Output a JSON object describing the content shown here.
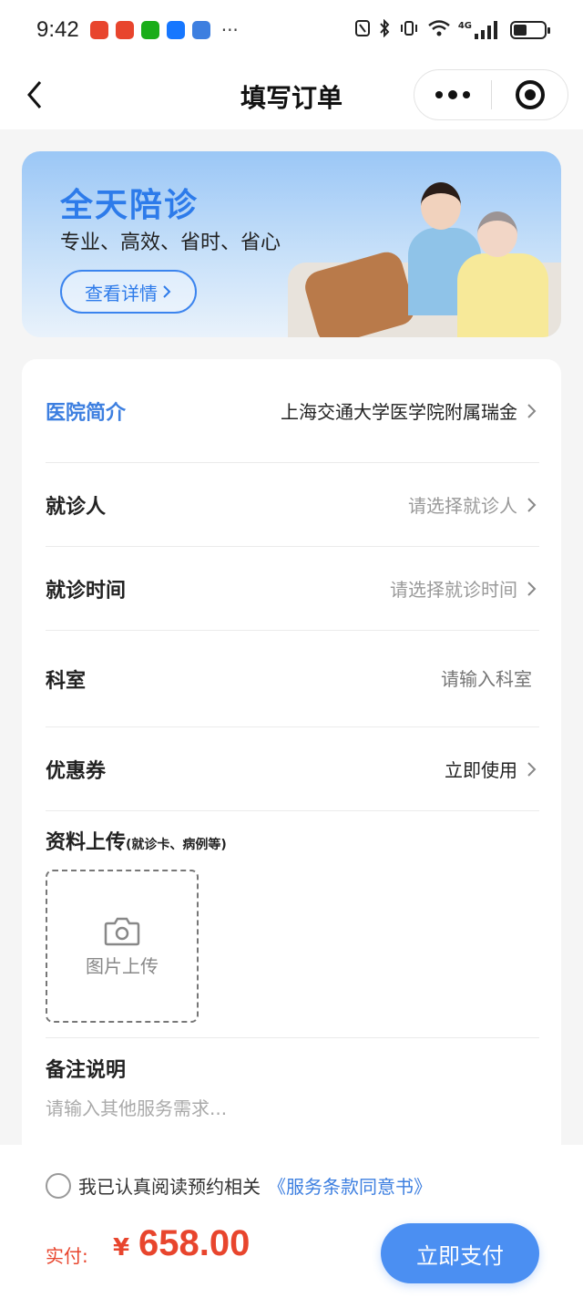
{
  "status_bar": {
    "time": "9:42",
    "more": "···",
    "network_badge": "4G",
    "app_icon_colors": [
      "#e8452d",
      "#e8452d",
      "#1aad19",
      "#1677ff",
      "#3d7fe0"
    ]
  },
  "nav": {
    "title": "填写订单",
    "back_icon": "back-chevron-icon",
    "more_icon": "more-dots-icon",
    "close_icon": "target-icon"
  },
  "banner": {
    "title": "全天陪诊",
    "subtitle": "专业、高效、省时、省心",
    "button_label": "查看详情"
  },
  "form": {
    "hospital": {
      "label": "医院简介",
      "value": "上海交通大学医学院附属瑞金"
    },
    "patient": {
      "label": "就诊人",
      "value": "请选择就诊人"
    },
    "visit_time": {
      "label": "就诊时间",
      "value": "请选择就诊时间"
    },
    "department": {
      "label": "科室",
      "placeholder": "请输入科室"
    },
    "coupon": {
      "label": "优惠券",
      "value": "立即使用"
    },
    "upload": {
      "title": "资料上传",
      "hint": "(就诊卡、病例等)",
      "button_label": "图片上传"
    },
    "remark": {
      "title": "备注说明",
      "placeholder": "请输入其他服务需求..."
    }
  },
  "footer": {
    "agree_text": "我已认真阅读预约相关",
    "agree_link": "《服务条款同意书》",
    "pay_label": "实付:",
    "currency": "¥",
    "amount": "658.00",
    "pay_button": "立即支付"
  },
  "colors": {
    "accent": "#3d7fe0",
    "price": "#e8452d",
    "pay_button": "#4b8ff2"
  }
}
